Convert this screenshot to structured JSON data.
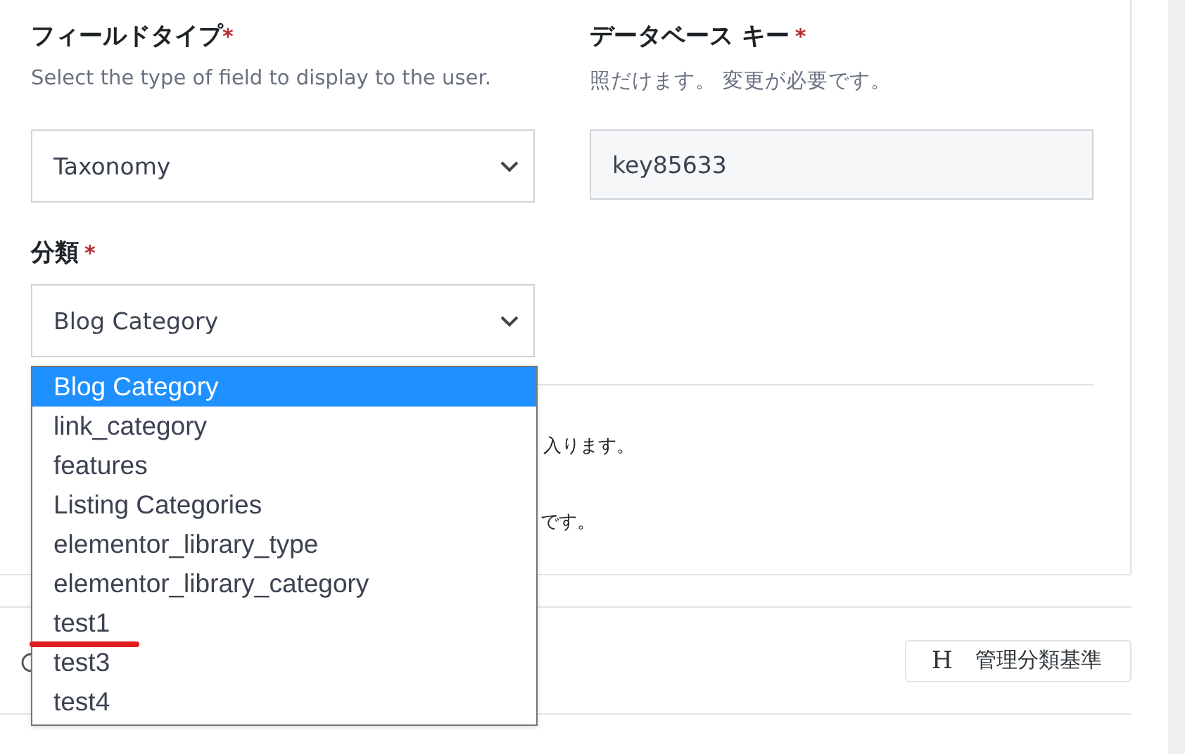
{
  "field_type": {
    "label": "フィールドタイプ",
    "required_mark": "*",
    "hint": "Select the type of field to display to the user.",
    "value": "Taxonomy"
  },
  "database_key": {
    "label": "データベース キー",
    "required_mark": "*",
    "hint": "照だけます。 変更が必要です。",
    "value": "key85633"
  },
  "taxonomy": {
    "label": "分類",
    "required_mark": "*",
    "value": "Blog Category",
    "expanded": true,
    "options": [
      {
        "label": "Blog Category",
        "selected": true,
        "underlined": false
      },
      {
        "label": "link_category",
        "selected": false,
        "underlined": false
      },
      {
        "label": "features",
        "selected": false,
        "underlined": false
      },
      {
        "label": "Listing Categories",
        "selected": false,
        "underlined": false
      },
      {
        "label": "elementor_library_type",
        "selected": false,
        "underlined": false
      },
      {
        "label": "elementor_library_category",
        "selected": false,
        "underlined": false
      },
      {
        "label": "test1",
        "selected": false,
        "underlined": true
      },
      {
        "label": "test3",
        "selected": false,
        "underlined": false
      },
      {
        "label": "test4",
        "selected": false,
        "underlined": false
      }
    ]
  },
  "hidden_texts": [
    "入ります。",
    "です。"
  ],
  "manage_button": {
    "icon": "H",
    "label": "管理分類基準"
  }
}
